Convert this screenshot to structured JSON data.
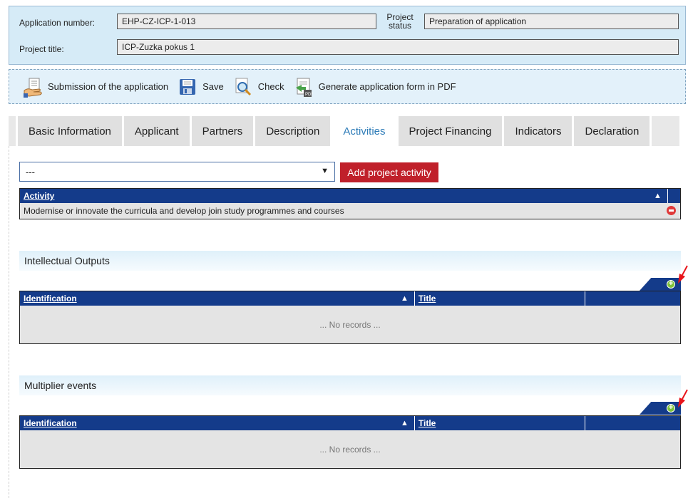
{
  "header": {
    "app_number_label": "Application number:",
    "app_number_value": "EHP-CZ-ICP-1-013",
    "status_label_line1": "Project",
    "status_label_line2": "status",
    "status_value": "Preparation of application",
    "title_label": "Project title:",
    "title_value": "ICP-Zuzka pokus 1"
  },
  "toolbar": {
    "submit_label": "Submission of the application",
    "save_label": "Save",
    "check_label": "Check",
    "pdf_label": "Generate application form in PDF"
  },
  "tabs": [
    {
      "label": "Basic Information",
      "active": false
    },
    {
      "label": "Applicant",
      "active": false
    },
    {
      "label": "Partners",
      "active": false
    },
    {
      "label": "Description",
      "active": false
    },
    {
      "label": "Activities",
      "active": true
    },
    {
      "label": "Project Financing",
      "active": false
    },
    {
      "label": "Indicators",
      "active": false
    },
    {
      "label": "Declaration",
      "active": false
    }
  ],
  "activities": {
    "select_value": "---",
    "add_button_label": "Add project activity",
    "column_activity": "Activity",
    "rows": [
      "Modernise or innovate the curricula and develop join study programmes and courses"
    ]
  },
  "intellectual_outputs": {
    "title": "Intellectual Outputs",
    "column_identification": "Identification",
    "column_title": "Title",
    "empty_text": "... No records ..."
  },
  "multiplier_events": {
    "title": "Multiplier events",
    "column_identification": "Identification",
    "column_title": "Title",
    "empty_text": "... No records ..."
  },
  "icons": {
    "submit": "hand-document-icon",
    "save": "floppy-disk-icon",
    "check": "magnifier-icon",
    "pdf": "pdf-document-icon",
    "sort": "sort-ascending-icon",
    "add": "plus-circle-icon",
    "remove": "minus-circle-icon"
  },
  "colors": {
    "header_bg": "#d6ebf7",
    "grid_header": "#143b8a",
    "add_button": "#c0202a",
    "active_tab_text": "#2e7cb8",
    "pointer": "#e8141b"
  }
}
